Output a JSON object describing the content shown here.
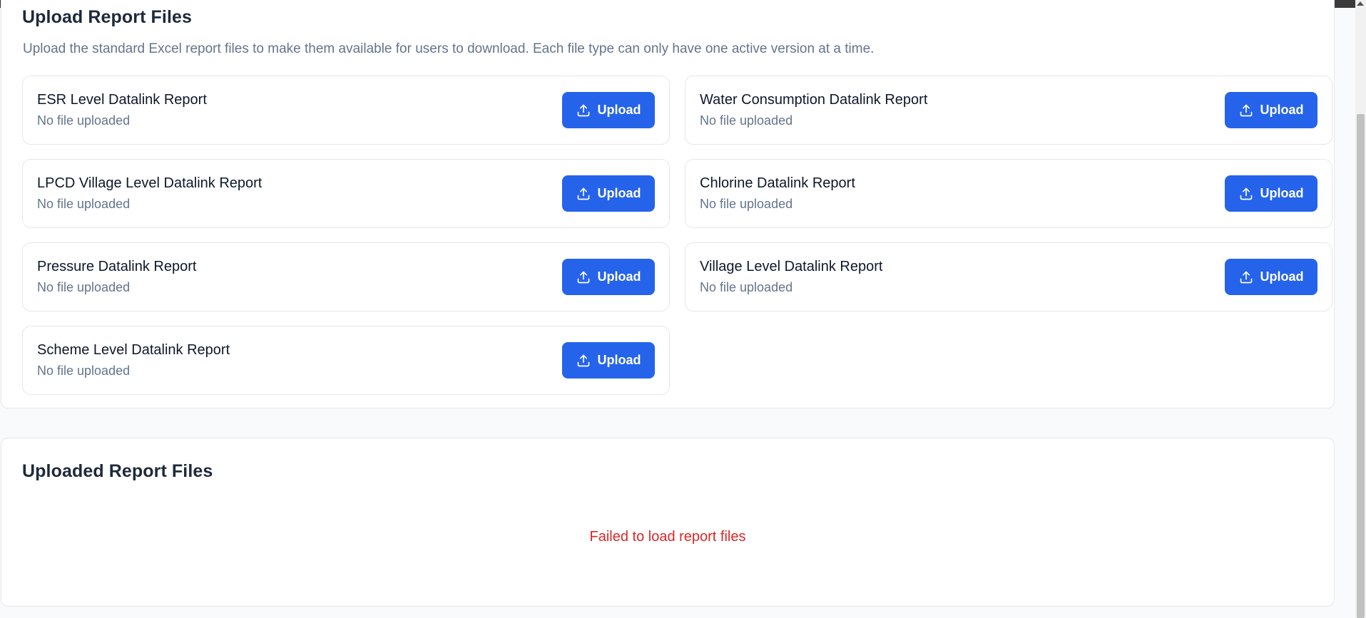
{
  "upload_section": {
    "title": "Upload Report Files",
    "description": "Upload the standard Excel report files to make them available for users to download. Each file type can only have one active version at a time.",
    "upload_label": "Upload",
    "files": [
      {
        "name": "ESR Level Datalink Report",
        "status": "No file uploaded"
      },
      {
        "name": "Water Consumption Datalink Report",
        "status": "No file uploaded"
      },
      {
        "name": "LPCD Village Level Datalink Report",
        "status": "No file uploaded"
      },
      {
        "name": "Chlorine Datalink Report",
        "status": "No file uploaded"
      },
      {
        "name": "Pressure Datalink Report",
        "status": "No file uploaded"
      },
      {
        "name": "Village Level Datalink Report",
        "status": "No file uploaded"
      },
      {
        "name": "Scheme Level Datalink Report",
        "status": "No file uploaded"
      }
    ]
  },
  "uploaded_section": {
    "title": "Uploaded Report Files",
    "error": "Failed to load report files"
  },
  "colors": {
    "primary": "#2563eb",
    "error": "#dc2626",
    "muted": "#64748b"
  },
  "icons": {
    "upload": "upload-icon"
  }
}
